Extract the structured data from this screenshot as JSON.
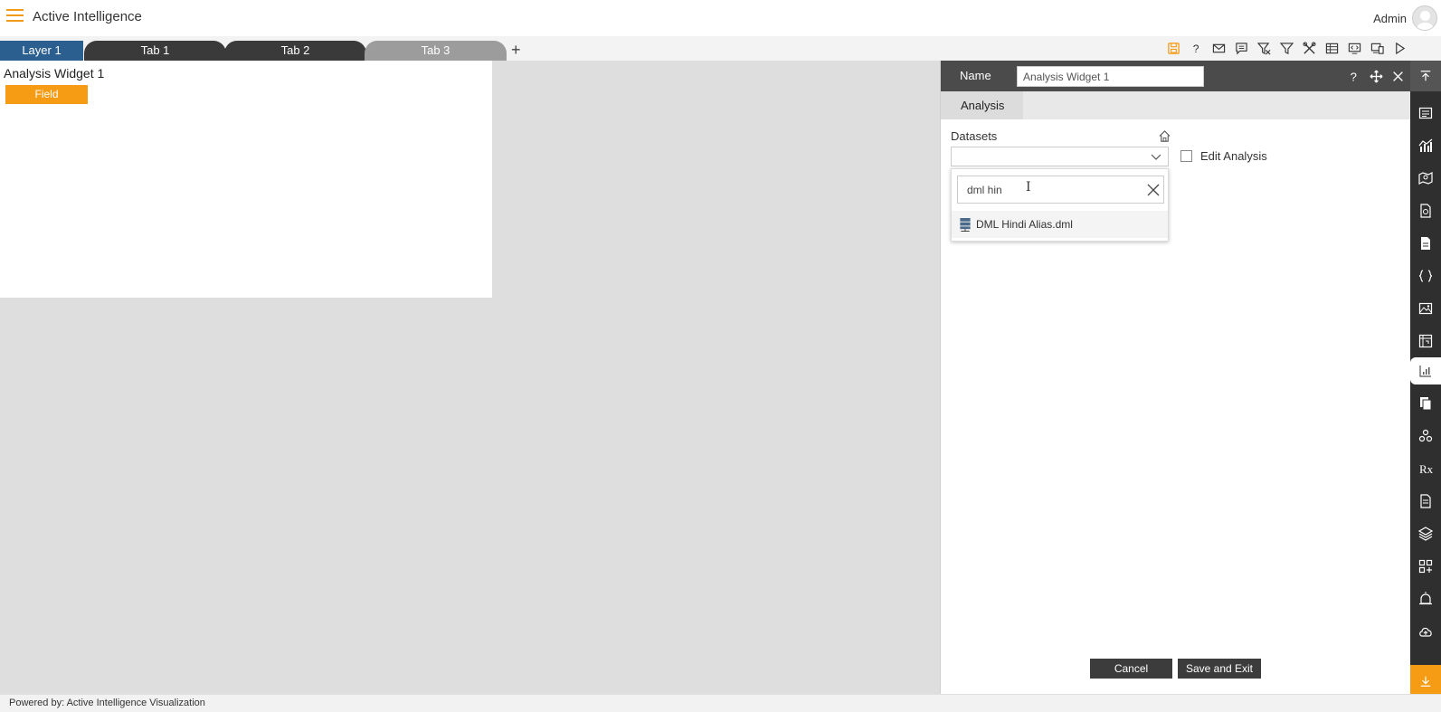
{
  "header": {
    "app_title": "Active Intelligence",
    "user_name": "Admin"
  },
  "tabs": [
    {
      "label": "Layer 1"
    },
    {
      "label": "Tab 1"
    },
    {
      "label": "Tab 2"
    },
    {
      "label": "Tab 3"
    }
  ],
  "add_tab_label": "+",
  "toolbar_icons": [
    "save-icon",
    "help-icon",
    "mail-icon",
    "comment-icon",
    "clear-filter-icon",
    "filter-icon",
    "tools-icon",
    "table-icon",
    "embed-icon",
    "devices-icon",
    "play-icon"
  ],
  "widget": {
    "title": "Analysis Widget 1",
    "field_button": "Field"
  },
  "panel": {
    "name_label": "Name",
    "name_value": "Analysis Widget 1",
    "tab_label": "Analysis",
    "datasets_label": "Datasets",
    "edit_analysis_label": "Edit Analysis",
    "edit_analysis_checked": false,
    "search_value": "dml hin",
    "option_label": "DML Hindi Alias.dml",
    "cancel_label": "Cancel",
    "save_label": "Save and Exit"
  },
  "rail_icons": [
    "collapse-up-icon",
    "report-icon",
    "chart-icon",
    "map-icon",
    "document-icon",
    "page-icon",
    "code-icon",
    "image-icon",
    "pivot-icon",
    "analysis-icon",
    "copy-icon",
    "cluster-icon",
    "formula-icon",
    "notes-icon",
    "layers-icon",
    "add-widget-icon",
    "alarm-icon",
    "cloud-upload-icon",
    "download-icon"
  ],
  "footer": {
    "text": "Powered by: Active Intelligence Visualization"
  },
  "colors": {
    "accent": "#f59b14",
    "layer_tab": "#2a5f8f",
    "dark": "#3a3a3a"
  }
}
